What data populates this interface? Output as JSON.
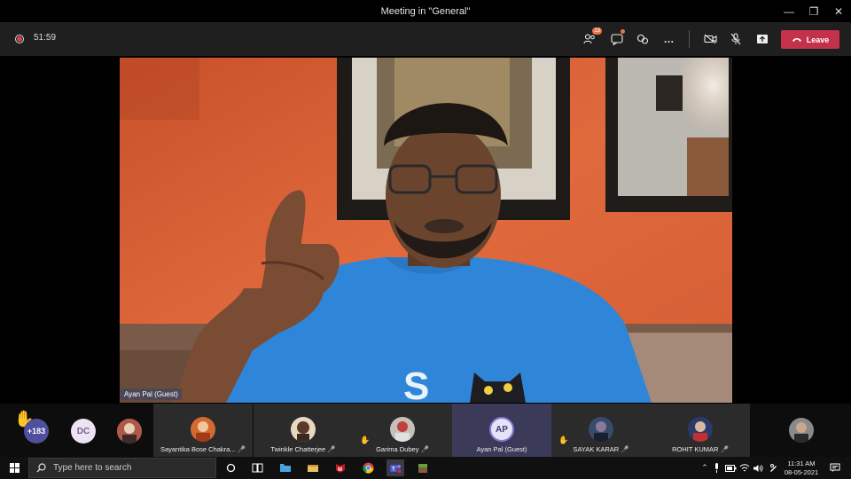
{
  "window": {
    "title": "Meeting in \"General\""
  },
  "toolbar": {
    "timer": "51:59",
    "participants_badge": "13",
    "leave_label": "Leave"
  },
  "stage": {
    "speaker_label": "Ayan Pal (Guest)"
  },
  "strip": {
    "raised_hands_count": "+183",
    "dc_initials": "DC",
    "tiles": [
      {
        "name": "Sayantika Bose Chakra..."
      },
      {
        "name": "Twinkle Chatterjee"
      },
      {
        "name": "Garima Dubey"
      },
      {
        "name": "Ayan Pal (Guest)",
        "initials": "AP"
      },
      {
        "name": "SAYAK KARAR"
      },
      {
        "name": "ROHIT KUMAR"
      }
    ]
  },
  "taskbar": {
    "search_placeholder": "Type here to search",
    "time": "11:31 AM",
    "date": "08-05-2021"
  },
  "colors": {
    "leave": "#c4314b",
    "active_tile": "#3b3a58",
    "badge": "#e97548"
  }
}
